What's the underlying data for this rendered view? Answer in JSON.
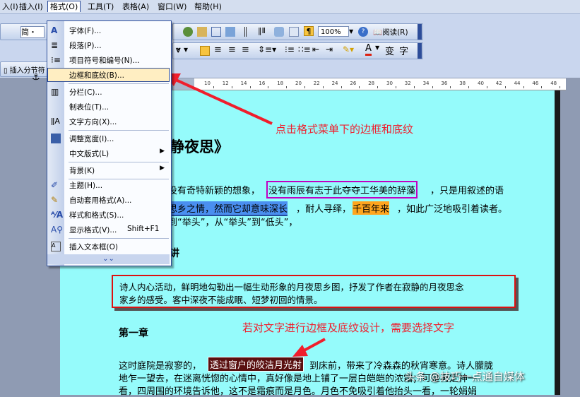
{
  "menubar": {
    "items": [
      {
        "label": "入(I)"
      },
      {
        "label": "插入(I)"
      },
      {
        "label": "格式(O)"
      },
      {
        "label": "工具(T)"
      },
      {
        "label": "表格(A)"
      },
      {
        "label": "窗口(W)"
      },
      {
        "label": "帮助(H)"
      }
    ]
  },
  "toolbar": {
    "style_box": "简・",
    "zoom": "100%",
    "read_label": "阅读(R)",
    "insert_section_label": "插入分节符"
  },
  "format_menu": {
    "items": [
      {
        "label": "字体(F)...",
        "icon": "font-A-icon"
      },
      {
        "label": "段落(P)...",
        "icon": "paragraph-icon"
      },
      {
        "label": "项目符号和编号(N)...",
        "icon": "bullets-icon"
      },
      {
        "label": "边框和底纹(B)...",
        "icon": ""
      },
      {
        "label": "分栏(C)...",
        "icon": "columns-icon"
      },
      {
        "label": "制表位(T)...",
        "icon": ""
      },
      {
        "label": "文字方向(X)...",
        "icon": "text-direction-icon"
      },
      {
        "label": "调整宽度(I)...",
        "icon": "fit-width-icon"
      },
      {
        "label": "中文版式(L)",
        "icon": ""
      },
      {
        "label": "背景(K)",
        "icon": ""
      },
      {
        "label": "主题(H)...",
        "icon": "theme-icon"
      },
      {
        "label": "自动套用格式(A)...",
        "icon": "autoformat-icon"
      },
      {
        "label": "样式和格式(S)...",
        "icon": "styles-icon"
      },
      {
        "label": "显示格式(V)...",
        "icon": "reveal-format-icon",
        "shortcut": "Shift+F1"
      },
      {
        "label": "插入文本框(O)",
        "icon": "textbox-icon"
      }
    ],
    "expand_icon": "double-chevron-down-icon"
  },
  "ruler": {
    "numbers": [
      "10",
      "12",
      "14",
      "16",
      "18",
      "20",
      "22",
      "24",
      "26",
      "28",
      "30",
      "32",
      "34",
      "36",
      "38",
      "40",
      "42",
      "44",
      "46",
      "48"
    ]
  },
  "document": {
    "title": "静夜思》",
    "line1a": "没有奇特新颖的想象，",
    "line1b": "没有雨辰有志于此夺夺工华美的辞藻",
    "line1c": "，只是用叙述的语",
    "line2a": "思乡之情，然而它却意味深长",
    "line2b": "，耐人寻绎，",
    "line2c": "千百年来",
    "line2d": "，如此广泛地吸引着读者。",
    "line3": "到“举头”，从“举头”到“低头”，",
    "heading2": "讲",
    "box_text1": "诗人内心活动，鲜明地勾勒出一幅生动形象的月夜思乡图，抒发了作者在寂静的月夜思念",
    "box_text2": "家乡的感受。客中深夜不能成眠、短梦初回的情景。",
    "chapter": "第一章",
    "p1a": "这时庭院是寂寥的，",
    "p1b": "透过窗户的皎洁月光射",
    "p1c": "到床前，带来了冷森森的秋宵寒意。诗人朦胧",
    "p2": "地乍一望去，在迷离恍惚的心情中，真好像是地上铺了一层白皑皑的浓霜；可是再定神一",
    "p3": "看，四周围的环境告诉他，这不是霜痕而是月色。月色不免吸引着他抬头一看，一轮娟娟"
  },
  "annotations": {
    "a1": "点击格式菜单下的边框和底纹",
    "a2": "若对文字进行边框及底纹设计，需要选择文字"
  },
  "watermark": "头条 @技巧一点通自媒体",
  "colors": {
    "page": "#95fbfb",
    "annotation": "#f01e2c",
    "menu_highlight": "#ffeec2",
    "menu_border": "#2d4d99"
  }
}
